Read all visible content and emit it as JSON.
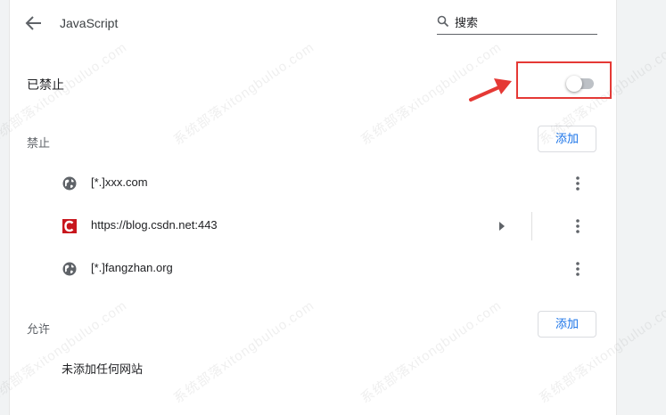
{
  "header": {
    "title": "JavaScript",
    "search_placeholder": "搜索"
  },
  "main_toggle": {
    "label": "已禁止",
    "state": "off"
  },
  "block_section": {
    "label": "禁止",
    "add_label": "添加",
    "sites": [
      {
        "name": "[*.]xxx.com",
        "icon": "globe-icon"
      },
      {
        "name": "https://blog.csdn.net:443",
        "icon": "csdn-logo-icon"
      },
      {
        "name": "[*.]fangzhan.org",
        "icon": "globe-icon"
      }
    ]
  },
  "allow_section": {
    "label": "允许",
    "add_label": "添加",
    "empty_text": "未添加任何网站"
  },
  "watermark": {
    "text": "系统部落xitongbuluo.com"
  },
  "colors": {
    "accent": "#1a73e8",
    "highlight": "#e53935",
    "csdn_red": "#c8161d"
  }
}
